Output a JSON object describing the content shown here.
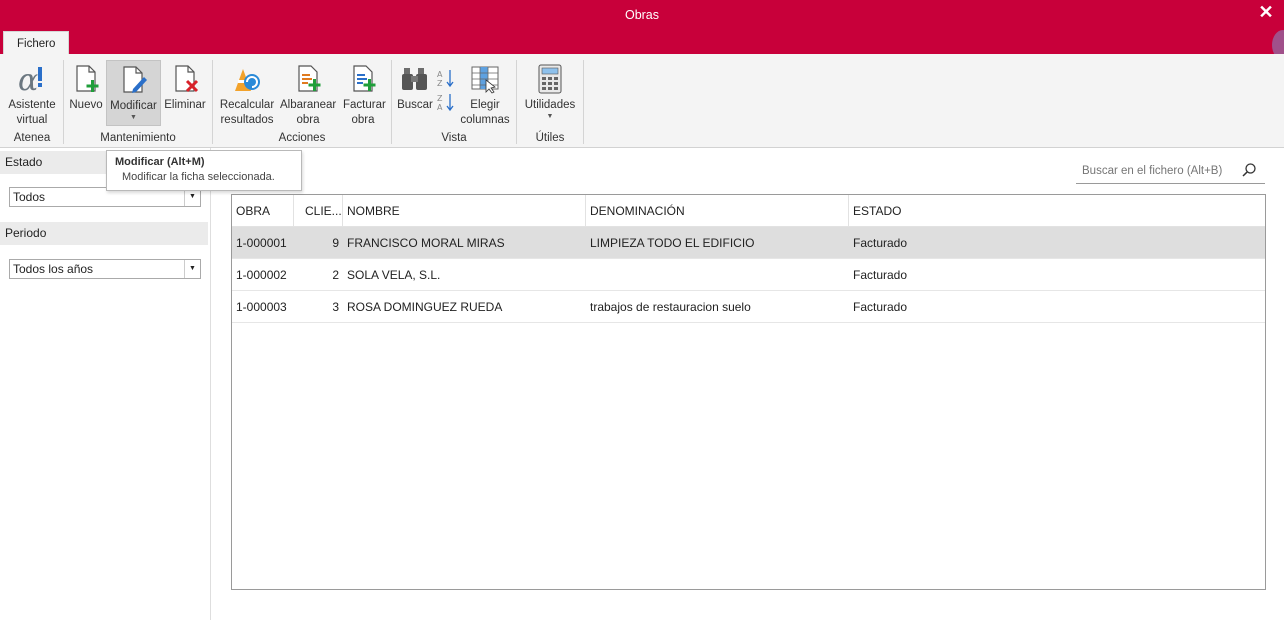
{
  "window": {
    "title": "Obras",
    "close": "✕"
  },
  "tabs": [
    {
      "label": "Fichero"
    }
  ],
  "ribbon": {
    "buttons": {
      "asistente": "Asistente virtual",
      "nuevo": "Nuevo",
      "modificar": "Modificar",
      "eliminar": "Eliminar",
      "recalcular": "Recalcular resultados",
      "albaranear": "Albaranear obra",
      "facturar": "Facturar obra",
      "buscar": "Buscar",
      "elegir": "Elegir columnas",
      "utilidades": "Utilidades"
    },
    "groups": {
      "atenea": "Atenea",
      "mantenimiento": "Mantenimiento",
      "acciones": "Acciones",
      "vista": "Vista",
      "utiles": "Útiles"
    },
    "icons": [
      "alpha-icon",
      "new-document-icon",
      "edit-document-icon",
      "delete-document-icon",
      "recalculate-icon",
      "add-delivery-note-icon",
      "add-invoice-icon",
      "binoculars-icon",
      "sort-az-icon",
      "sort-za-icon",
      "columns-icon",
      "calculator-icon"
    ]
  },
  "tooltip": {
    "title": "Modificar (Alt+M)",
    "description": "Modificar la ficha seleccionada."
  },
  "sidebar": {
    "estado_label": "Estado",
    "estado_value": "Todos",
    "periodo_label": "Periodo",
    "periodo_value": "Todos los años"
  },
  "search": {
    "placeholder": "Buscar en el fichero (Alt+B)"
  },
  "table": {
    "headers": {
      "obra": "OBRA",
      "cliente": "CLIE...",
      "nombre": "NOMBRE",
      "denominacion": "DENOMINACIÓN",
      "estado": "ESTADO"
    },
    "rows": [
      {
        "obra": "1-000001",
        "cliente": "9",
        "nombre": "FRANCISCO MORAL MIRAS",
        "denominacion": "LIMPIEZA TODO EL EDIFICIO",
        "estado": "Facturado"
      },
      {
        "obra": "1-000002",
        "cliente": "2",
        "nombre": "SOLA VELA, S.L.",
        "denominacion": "",
        "estado": "Facturado"
      },
      {
        "obra": "1-000003",
        "cliente": "3",
        "nombre": "ROSA DOMINGUEZ RUEDA",
        "denominacion": "trabajos de restauracion suelo",
        "estado": "Facturado"
      }
    ],
    "selected_row": 0
  },
  "colors": {
    "titlebar": "#c8003a",
    "ribbon": "#f4f4f4",
    "selection": "#dedede",
    "accent_green": "#1f9e3a",
    "accent_red": "#d8222a",
    "accent_blue": "#2a6fc9"
  }
}
